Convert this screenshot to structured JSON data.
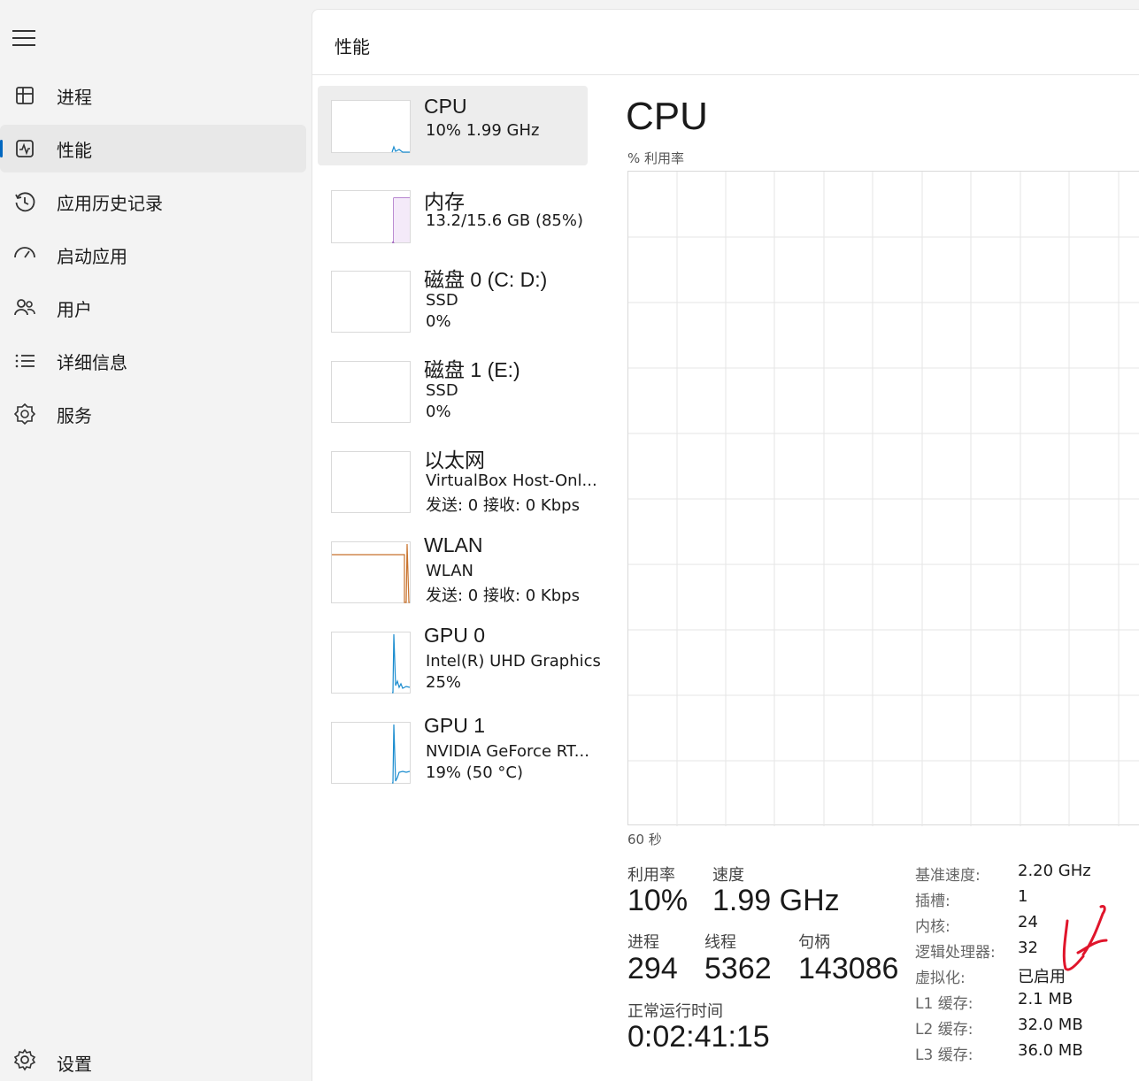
{
  "sidebar": {
    "items": [
      {
        "label": "进程"
      },
      {
        "label": "性能"
      },
      {
        "label": "应用历史记录"
      },
      {
        "label": "启动应用"
      },
      {
        "label": "用户"
      },
      {
        "label": "详细信息"
      },
      {
        "label": "服务"
      }
    ],
    "settings_label": "设置"
  },
  "header": {
    "title": "性能"
  },
  "resources": [
    {
      "name": "CPU",
      "line1": "10%  1.99 GHz",
      "line2": ""
    },
    {
      "name": "内存",
      "line1": "13.2/15.6 GB (85%)",
      "line2": ""
    },
    {
      "name": "磁盘 0 (C: D:)",
      "line1": "SSD",
      "line2": "0%"
    },
    {
      "name": "磁盘 1 (E:)",
      "line1": "SSD",
      "line2": "0%"
    },
    {
      "name": "以太网",
      "line1": "VirtualBox Host-Onl...",
      "line2": "发送: 0 接收: 0 Kbps"
    },
    {
      "name": "WLAN",
      "line1": "WLAN",
      "line2": "发送: 0 接收: 0 Kbps"
    },
    {
      "name": "GPU 0",
      "line1": "Intel(R) UHD Graphics",
      "line2": "25%"
    },
    {
      "name": "GPU 1",
      "line1": "NVIDIA GeForce RT...",
      "line2": "19%  (50 °C)"
    }
  ],
  "detail": {
    "title": "CPU",
    "graph_label": "% 利用率",
    "graph_time": "60 秒",
    "stats": {
      "utilization_label": "利用率",
      "utilization": "10%",
      "speed_label": "速度",
      "speed": "1.99 GHz",
      "processes_label": "进程",
      "processes": "294",
      "threads_label": "线程",
      "threads": "5362",
      "handles_label": "句柄",
      "handles": "143086",
      "uptime_label": "正常运行时间",
      "uptime": "0:02:41:15"
    },
    "properties": [
      {
        "label": "基准速度:",
        "value": "2.20 GHz"
      },
      {
        "label": "插槽:",
        "value": "1"
      },
      {
        "label": "内核:",
        "value": "24"
      },
      {
        "label": "逻辑处理器:",
        "value": "32"
      },
      {
        "label": "虚拟化:",
        "value": "已启用"
      },
      {
        "label": "L1 缓存:",
        "value": "2.1 MB"
      },
      {
        "label": "L2 缓存:",
        "value": "32.0 MB"
      },
      {
        "label": "L3 缓存:",
        "value": "36.0 MB"
      }
    ]
  },
  "colors": {
    "accent": "#0067c0",
    "cpu_line": "#1a8ccf",
    "memory_line": "#8e3fb5",
    "wlan_line": "#c8722c",
    "annotation": "#e0152b"
  }
}
